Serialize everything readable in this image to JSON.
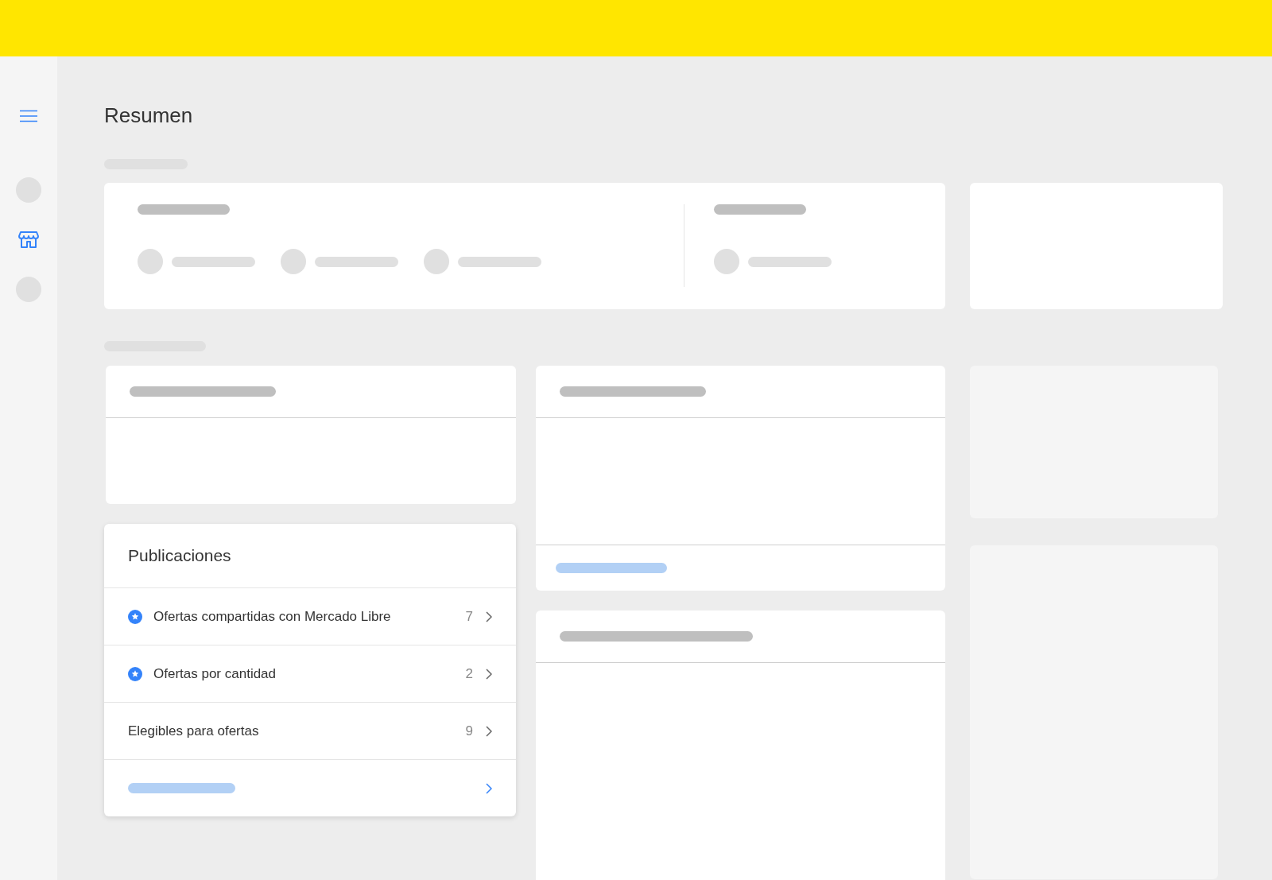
{
  "page": {
    "title": "Resumen"
  },
  "publicaciones": {
    "title": "Publicaciones",
    "items": [
      {
        "label": "Ofertas compartidas con Mercado Libre",
        "count": "7",
        "starred": true
      },
      {
        "label": "Ofertas por cantidad",
        "count": "2",
        "starred": true
      },
      {
        "label": "Elegibles para ofertas",
        "count": "9",
        "starred": false
      }
    ]
  }
}
